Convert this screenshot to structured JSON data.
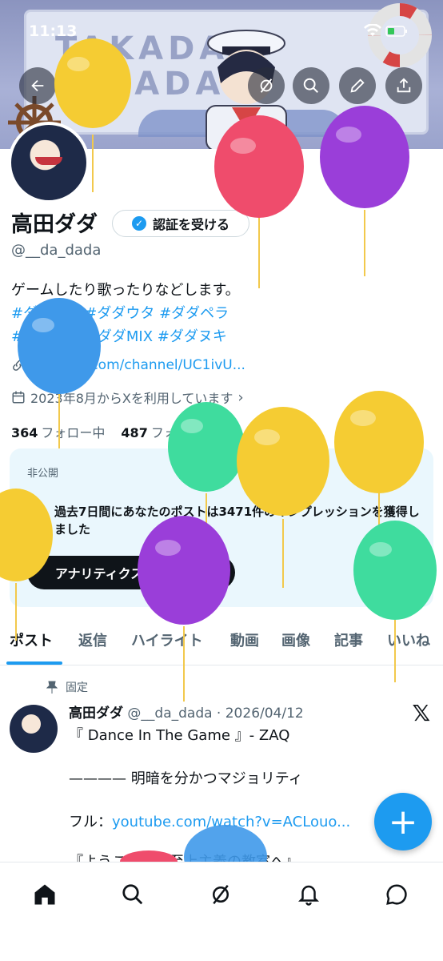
{
  "status": {
    "time": "11:13"
  },
  "header": {
    "banner_text_line1": "TAKADA",
    "banner_text_line2": "DADA"
  },
  "profile": {
    "name": "高田ダダ",
    "verify_label": "認証を受ける",
    "handle": "@__da_dada",
    "bio_line1": "ゲームしたり歌ったりなどします。",
    "hashtags_line1": "#ダダメシ #ダダウタ #ダダペラ",
    "hashtags_line2": "#ダダハモ #ダダMIX #ダダヌキ",
    "link": "youtube.com/channel/UC1ivU...",
    "joined": "2023年8月からXを利用しています",
    "following_count": "364",
    "following_label": "フォロー中",
    "followers_count": "487",
    "followers_label": "フォロワー"
  },
  "card": {
    "private_label": "非公開",
    "text": "過去7日間にあなたのポストは3471件のインプレッションを獲得しました",
    "button": "アナリティクスを利用する"
  },
  "tabs": [
    "ポスト",
    "返信",
    "ハイライト",
    "動画",
    "画像",
    "記事",
    "いいね"
  ],
  "post": {
    "pinned_label": "固定",
    "author": "高田ダダ",
    "handle_date": "@__da_dada · 2026/04/12",
    "line1": "『 Dance In The Game 』- ZAQ",
    "line2": "———— 明暗を分かつマジョリティ",
    "line3_prefix": "フル：",
    "line3_link": "youtube.com/watch?v=ACLouo...",
    "line4": "『ようこそ実力至上主義の教室へ』"
  },
  "colors": {
    "accent": "#1d9bf0",
    "text": "#0f1419",
    "muted": "#536471"
  }
}
